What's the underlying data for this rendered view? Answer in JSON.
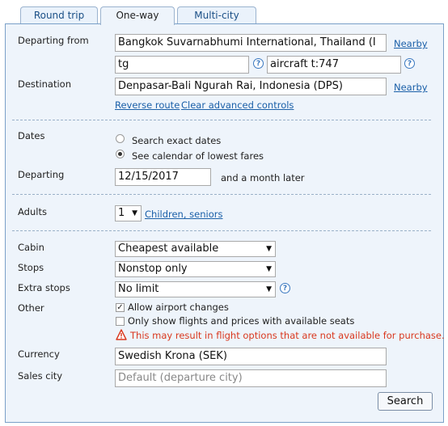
{
  "tabs": [
    {
      "label": "Round trip"
    },
    {
      "label": "One-way"
    },
    {
      "label": "Multi-city"
    }
  ],
  "route": {
    "departing_label": "Departing from",
    "departing_value": "Bangkok Suvarnabhumi International, Thailand (I",
    "nearby_label": "Nearby",
    "carrier_value": "tg",
    "aircraft_value": "aircraft t:747",
    "destination_label": "Destination",
    "destination_value": "Denpasar-Bali Ngurah Rai, Indonesia (DPS)",
    "nearby2_label": "Nearby",
    "reverse_label": "Reverse route",
    "clear_label": "Clear advanced controls"
  },
  "dates": {
    "label": "Dates",
    "option_exact": "Search exact dates",
    "option_calendar": "See calendar of lowest fares",
    "selected": "calendar",
    "departing_label": "Departing",
    "departing_value": "12/15/2017",
    "later_text": "and a month later"
  },
  "passengers": {
    "adults_label": "Adults",
    "adults_value": "1",
    "children_link": "Children, seniors"
  },
  "options": {
    "cabin_label": "Cabin",
    "cabin_value": "Cheapest available",
    "stops_label": "Stops",
    "stops_value": "Nonstop only",
    "extra_label": "Extra stops",
    "extra_value": "No limit",
    "other_label": "Other",
    "allow_changes": "Allow airport changes",
    "allow_changes_checked": true,
    "only_available": "Only show flights and prices with available seats",
    "only_available_checked": false,
    "warning": "This may result in flight options that are not available for purchase.",
    "warning_color": "#d9381e"
  },
  "currency": {
    "label": "Currency",
    "value": "Swedish Krona (SEK)"
  },
  "sales": {
    "label": "Sales city",
    "placeholder": "Default (departure city)"
  },
  "search_label": "Search"
}
